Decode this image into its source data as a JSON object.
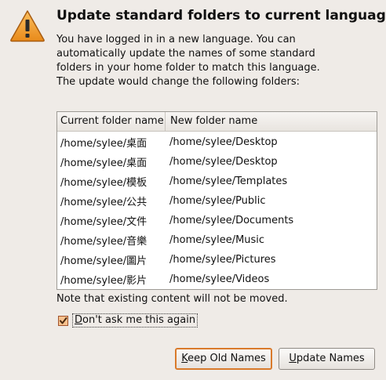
{
  "dialog": {
    "title": "Update standard folders to current language?",
    "message": "You have logged in in a new language. You can automatically update the names of some standard folders in your home folder to match this language. The update would change the following folders:",
    "icon": "warning-icon"
  },
  "table": {
    "headers": {
      "current": "Current folder name",
      "new": "New folder name"
    },
    "rows": [
      {
        "current": "/home/sylee/桌面",
        "new": "/home/sylee/Desktop"
      },
      {
        "current": "/home/sylee/桌面",
        "new": "/home/sylee/Desktop"
      },
      {
        "current": "/home/sylee/模板",
        "new": "/home/sylee/Templates"
      },
      {
        "current": "/home/sylee/公共",
        "new": "/home/sylee/Public"
      },
      {
        "current": "/home/sylee/文件",
        "new": "/home/sylee/Documents"
      },
      {
        "current": "/home/sylee/音樂",
        "new": "/home/sylee/Music"
      },
      {
        "current": "/home/sylee/圖片",
        "new": "/home/sylee/Pictures"
      },
      {
        "current": "/home/sylee/影片",
        "new": "/home/sylee/Videos"
      }
    ]
  },
  "note": "Note that existing content will not be moved.",
  "checkbox": {
    "label_first": "D",
    "label_rest": "on't ask me this again",
    "checked": true
  },
  "buttons": {
    "keep_first": "K",
    "keep_rest": "eep Old Names",
    "update_first": "U",
    "update_rest": "pdate Names"
  },
  "colors": {
    "warning_fill": "#f0a030",
    "focus_border": "#d97a2b",
    "checkbox_fill": "#f7c28e"
  }
}
